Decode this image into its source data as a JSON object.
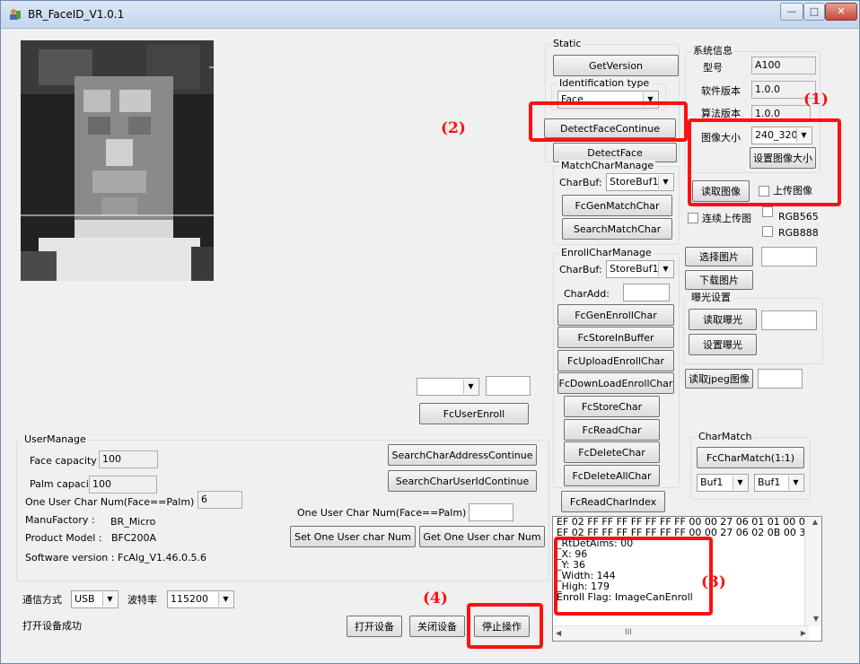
{
  "window": {
    "title": "BR_FaceID_V1.0.1",
    "min": "—",
    "max": "□",
    "close": "✕"
  },
  "static_group": {
    "title": "Static",
    "get_version": "GetVersion",
    "ident_title": "Identification type",
    "ident_value": "Face",
    "detect_continue": "DetectFaceContinue",
    "detect_face": "DetectFace"
  },
  "sysinfo": {
    "title": "系统信息",
    "model_label": "型号",
    "model_value": "A100",
    "sw_label": "软件版本",
    "sw_value": "1.0.0",
    "alg_label": "算法版本",
    "alg_value": "1.0.0",
    "img_size_label": "图像大小",
    "img_size_value": "240_320",
    "set_img_size": "设置图像大小",
    "read_img": "读取图像",
    "upload_img": "上传图像",
    "cont_upload": "连续上传图",
    "rgb565": "RGB565",
    "rgb888": "RGB888",
    "select_img": "选择图片",
    "download_img": "下载图片"
  },
  "exposure": {
    "title": "曝光设置",
    "read": "读取曝光",
    "set": "设置曝光",
    "read_jpeg": "读取jpeg图像"
  },
  "match": {
    "title": "MatchCharManage",
    "charbuf_label": "CharBuf:",
    "charbuf_value": "StoreBuf1",
    "gen": "FcGenMatchChar",
    "search": "SearchMatchChar"
  },
  "enroll": {
    "title": "EnrollCharManage",
    "charbuf_label": "CharBuf:",
    "charbuf_value": "StoreBuf1",
    "charadd_label": "CharAdd:",
    "gen": "FcGenEnrollChar",
    "store_in_buffer": "FcStoreInBuffer",
    "upload": "FcUploadEnrollChar",
    "download": "FcDownLoadEnrollChar",
    "store": "FcStoreChar",
    "read": "FcReadChar",
    "delete": "FcDeleteChar",
    "delete_all": "FcDeleteAllChar"
  },
  "read_index": "FcReadCharIndex",
  "charmatch": {
    "title": "CharMatch",
    "btn": "FcCharMatch(1:1)",
    "buf_a": "Buf1",
    "buf_b": "Buf1"
  },
  "user_enroll": "FcUserEnroll",
  "usermanage": {
    "title": "UserManage",
    "face_cap_label": "Face capacity",
    "face_cap_value": "100",
    "palm_cap_label": "Palm capacity",
    "palm_cap_value": "100",
    "one_user_label": "One User Char Num(Face==Palm)",
    "one_user_value": "6",
    "manufactory_label": "ManuFactory  :",
    "manufactory_value": "BR_Micro",
    "product_label": "Product Model :",
    "product_value": "BFC200A",
    "software_label": "Software version : ",
    "software_value": "FcAlg_V1.46.0.5.6",
    "search_addr": "SearchCharAddressContinue",
    "search_uid": "SearchCharUserIdContinue",
    "one_user_label2": "One User Char Num(Face==Palm)",
    "set_num": "Set One User char Num",
    "get_num": "Get One User char Num"
  },
  "comm": {
    "mode_label": "通信方式",
    "mode_value": "USB",
    "baud_label": "波特率",
    "baud_value": "115200",
    "status": "打开设备成功",
    "open": "打开设备",
    "close": "关闭设备",
    "stop": "停止操作"
  },
  "log": {
    "lines": [
      "EF 02 FF FF FF FF FF FF FF 00 00 27 06 01 01 00 00",
      "EF 02 FF FF FF FF FF FF FF 00 00 27 06 02 0B 00 39",
      "_RtDetAims: 00",
      "_X: 96",
      "_Y: 36",
      "_Width: 144",
      "_High: 179",
      "Enroll Flag: ImageCanEnroll"
    ],
    "scroll_mark": "III"
  },
  "annotations": [
    "(1)",
    "(2)",
    "(3)",
    "(4)"
  ],
  "colors": {
    "annotation": "#ff1010"
  }
}
